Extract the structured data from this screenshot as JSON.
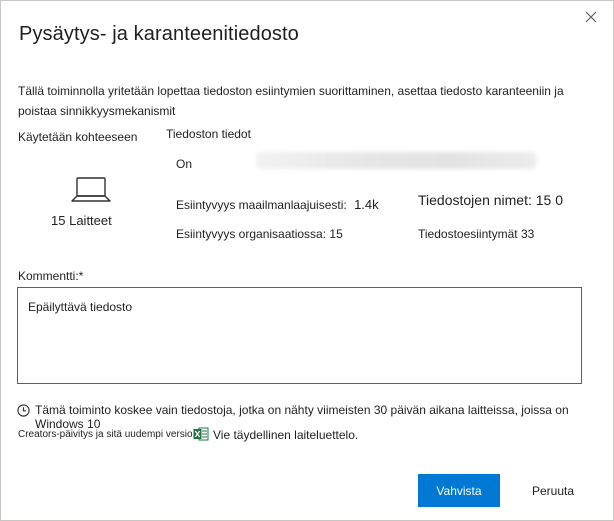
{
  "dialog": {
    "title": "Pysäytys- ja karanteenitiedosto",
    "close_icon": "close-icon",
    "description": "Tällä toiminnolla yritetään lopettaa tiedoston esiintymien suorittaminen, asettaa tiedosto karanteeniin ja poistaa sinnikkyysmekanismit"
  },
  "applied_to": {
    "label": "Käytetään kohteeseen",
    "icon": "laptop-icon",
    "count": "15",
    "count_label": "Laitteet"
  },
  "file_details": {
    "label": "Tiedoston tiedot",
    "on_label": "On",
    "worldwide_label": "Esiintyvyys maailmanlaajuisesti:",
    "worldwide_value": "1.4k",
    "org_label": "Esiintyvyys organisaatiossa:",
    "org_value": "15",
    "names_label": "Tiedostojen nimet:",
    "names_value": "15 0",
    "occurrences_label": "Tiedostoesiintymät",
    "occurrences_value": "33"
  },
  "comment": {
    "label": "Kommentti:*",
    "value": "Epäilyttävä tiedosto"
  },
  "note": {
    "icon": "clock-icon",
    "line1": "Tämä toiminto koskee vain tiedostoja, jotka on nähty viimeisten 30 päivän aikana laitteissa, joissa on Windows 10",
    "line2": "Creators-päivitys ja sitä uudempi versio",
    "export_icon": "excel-icon",
    "export_label": "Vie täydellinen laiteluettelo."
  },
  "buttons": {
    "confirm_label": "Vahvista",
    "cancel_label": "Peruuta"
  },
  "colors": {
    "accent": "#0078d4",
    "excel_green": "#217346"
  }
}
